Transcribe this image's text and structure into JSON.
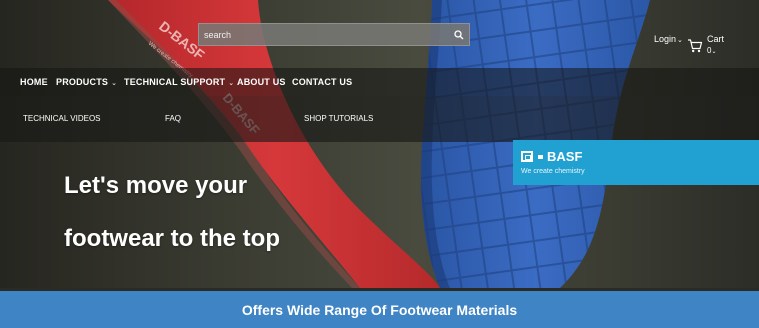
{
  "header": {
    "search_placeholder": "search",
    "login_label": "Login",
    "cart_label": "Cart",
    "cart_count": "0"
  },
  "mainnav": {
    "items": [
      {
        "label": "HOME",
        "has_dropdown": false
      },
      {
        "label": "PRODUCTS",
        "has_dropdown": true
      },
      {
        "label": "TECHNICAL SUPPORT",
        "has_dropdown": true
      },
      {
        "label": "ABOUT US",
        "has_dropdown": false
      },
      {
        "label": "CONTACT US",
        "has_dropdown": false
      }
    ]
  },
  "subnav": {
    "items": [
      {
        "label": "TECHNICAL VIDEOS"
      },
      {
        "label": "FAQ"
      },
      {
        "label": "SHOP TUTORIALS"
      }
    ]
  },
  "hero": {
    "headline_line1": "Let's move your",
    "headline_line2": "footwear to the top",
    "brand": {
      "name": "BASF",
      "tagline": "We create chemistry",
      "color": "#21a0d2"
    },
    "insole_text": "D-BASF",
    "insole_subtext": "We create chemistry"
  },
  "band": {
    "text": "Offers Wide Range Of Footwear Materials",
    "color": "#3f84c4"
  },
  "icons": {
    "search": "search-icon",
    "cart": "cart-icon",
    "chevron": "chevron-down-icon"
  }
}
